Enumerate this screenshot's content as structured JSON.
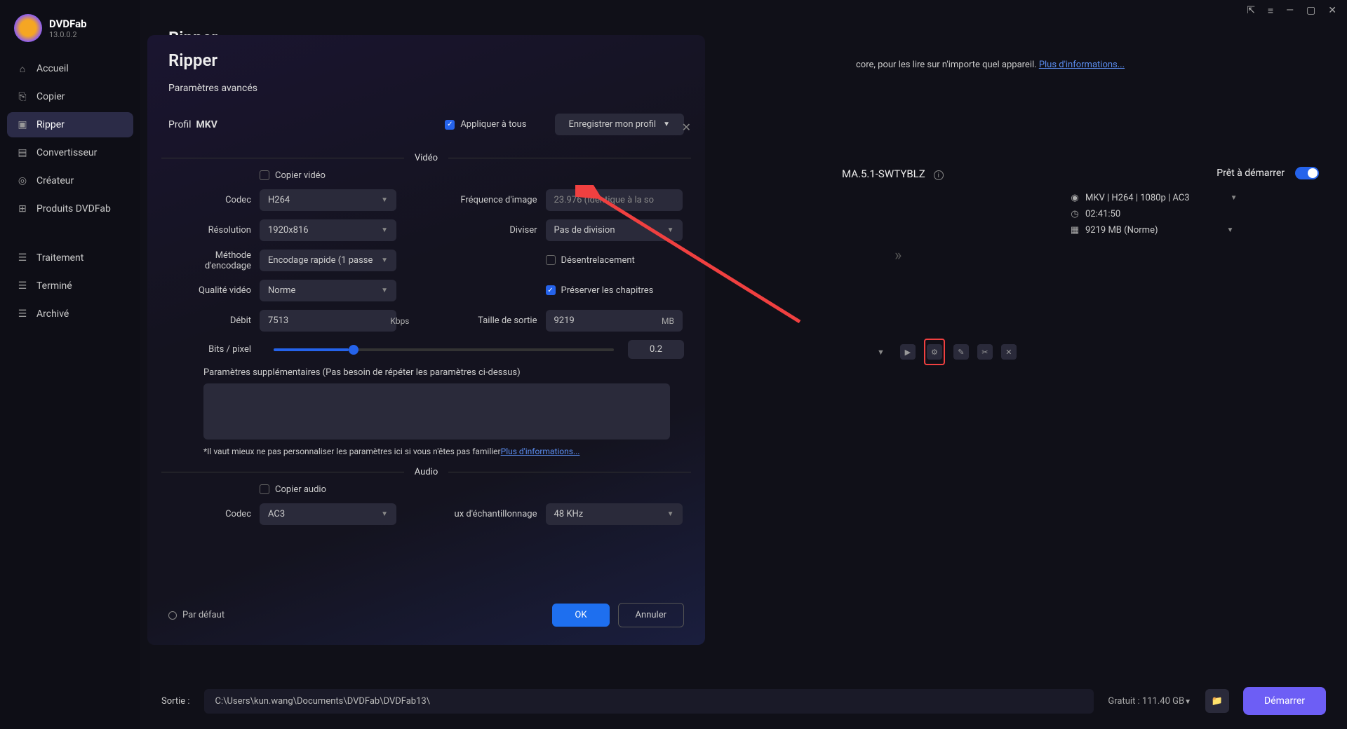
{
  "app": {
    "name": "DVDFab",
    "version": "13.0.0.2"
  },
  "sidebar": {
    "items": [
      {
        "label": "Accueil"
      },
      {
        "label": "Copier"
      },
      {
        "label": "Ripper"
      },
      {
        "label": "Convertisseur"
      },
      {
        "label": "Créateur"
      },
      {
        "label": "Produits DVDFab"
      }
    ],
    "bottom": [
      {
        "label": "Traitement"
      },
      {
        "label": "Terminé"
      },
      {
        "label": "Archivé"
      }
    ]
  },
  "header": {
    "title": "Ripper"
  },
  "desc": {
    "text": "core, pour les lire sur n'importe quel appareil. ",
    "link": "Plus d'informations..."
  },
  "task": {
    "name": "MA.5.1-SWTYBLZ",
    "ready": "Prêt à démarrer",
    "format": "MKV | H264 | 1080p | AC3",
    "duration": "02:41:50",
    "size": "9219 MB (Norme)"
  },
  "footer": {
    "output_label": "Sortie :",
    "path": "C:\\Users\\kun.wang\\Documents\\DVDFab\\DVDFab13\\",
    "free": "Gratuit : 111.40 GB",
    "start": "Démarrer"
  },
  "modal": {
    "title": "Ripper",
    "subtitle": "Paramètres avancés",
    "profile_label": "Profil",
    "profile_val": "MKV",
    "apply_all": "Appliquer à tous",
    "save_profile": "Enregistrer mon profil",
    "sec_video": "Vidéo",
    "copy_video": "Copier vidéo",
    "codec_l": "Codec",
    "codec_v": "H264",
    "fps_l": "Fréquence d'image",
    "fps_v": "23.976 (Identique à la so",
    "res_l": "Résolution",
    "res_v": "1920x816",
    "split_l": "Diviser",
    "split_v": "Pas de division",
    "enc_l": "Méthode d'encodage",
    "enc_v": "Encodage rapide (1 passe",
    "deint": "Désentrelacement",
    "qual_l": "Qualité vidéo",
    "qual_v": "Norme",
    "chapters": "Préserver les chapitres",
    "bitrate_l": "Débit",
    "bitrate_v": "7513",
    "bitrate_u": "Kbps",
    "outsize_l": "Taille de sortie",
    "outsize_v": "9219",
    "outsize_u": "MB",
    "bpp_l": "Bits / pixel",
    "bpp_v": "0.2",
    "extra_l": "Paramètres supplémentaires (Pas besoin de répéter les paramètres ci-dessus)",
    "hint": "*Il vaut mieux ne pas personnaliser les paramètres ici si vous n'êtes pas familier",
    "hint_link": "Plus d'informations...",
    "sec_audio": "Audio",
    "copy_audio": "Copier audio",
    "acodec_l": "Codec",
    "acodec_v": "AC3",
    "samp_l": "ux d'échantillonnage",
    "samp_v": "48 KHz",
    "default": "Par défaut",
    "ok": "OK",
    "cancel": "Annuler"
  }
}
